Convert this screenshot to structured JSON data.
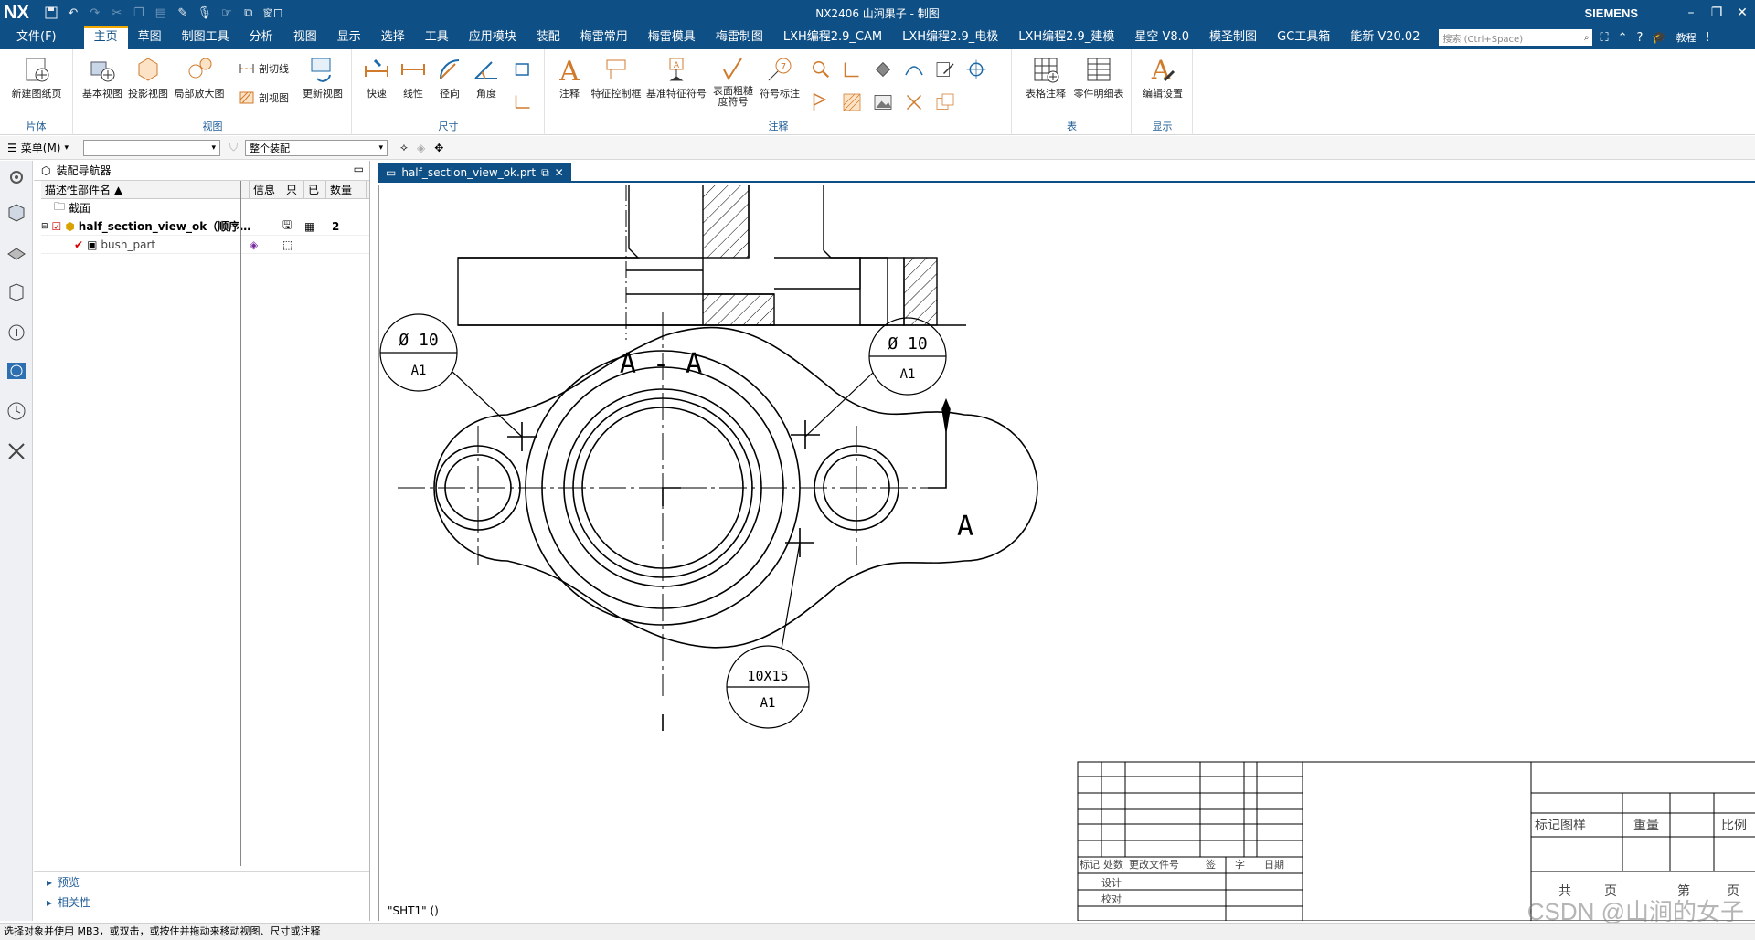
{
  "app": {
    "logo": "NX",
    "title": "NX2406 山涧果子 - 制图",
    "brand": "SIEMENS",
    "quick_window": "窗口"
  },
  "menu": {
    "file": "文件(F)",
    "items": [
      "主页",
      "草图",
      "制图工具",
      "分析",
      "视图",
      "显示",
      "选择",
      "工具",
      "应用模块",
      "装配",
      "梅雷常用",
      "梅雷模具",
      "梅雷制图",
      "LXH编程2.9_CAM",
      "LXH编程2.9_电极",
      "LXH编程2.9_建模",
      "星空 V8.0",
      "模圣制图",
      "GC工具箱",
      "能新 V20.02"
    ],
    "search_placeholder": "搜索 (Ctrl+Space)",
    "tutorial": "教程"
  },
  "ribbon": {
    "groups": {
      "sheet": "片体",
      "view": "视图",
      "dimension": "尺寸",
      "annotation": "注释",
      "table": "表",
      "display": "显示"
    },
    "buttons": {
      "new_sheet": "新建图纸页",
      "base_view": "基本视图",
      "projected_view": "投影视图",
      "detail_view": "局部放大图",
      "section_line": "剖切线",
      "section_view": "剖视图",
      "update_view": "更新视图",
      "rapid": "快速",
      "linear": "线性",
      "radial": "径向",
      "angular": "角度",
      "note": "注释",
      "fcf": "特征控制框",
      "datum": "基准特征符号",
      "surface_finish": "表面粗糙度符号",
      "id_symbol": "符号标注",
      "tabular_note": "表格注释",
      "parts_list": "零件明细表",
      "edit_settings": "编辑设置"
    }
  },
  "selbar": {
    "menu": "菜单(M)",
    "filter": "",
    "scope": "整个装配"
  },
  "navigator": {
    "title": "装配导航器",
    "columns": [
      "描述性部件名",
      "信息",
      "只",
      "已",
      "数量"
    ],
    "rows": [
      {
        "name": "截面",
        "qty": ""
      },
      {
        "name": "half_section_view_ok（顺序…",
        "qty": "2"
      },
      {
        "name": "bush_part",
        "qty": ""
      }
    ],
    "panels": [
      "预览",
      "相关性"
    ]
  },
  "tab": {
    "label": "half_section_view_ok.prt"
  },
  "drawing": {
    "section_label": "A - A",
    "arrow_label": "A",
    "balloon1": {
      "top": "Ø 10",
      "bottom": "A1"
    },
    "balloon2": {
      "top": "Ø 10",
      "bottom": "A1"
    },
    "balloon3": {
      "top": "10X15",
      "bottom": "A1"
    },
    "title_block": {
      "row_labels": [
        "标记",
        "处数",
        "更改文件号",
        "签",
        "字",
        "日期"
      ],
      "design": "设计",
      "check": "校对",
      "mark_pattern": "标记图样",
      "weight": "重量",
      "scale": "比例",
      "total": "共",
      "page": "页",
      "no": "第",
      "page2": "页"
    },
    "sheet_name": "\"SHT1\" ()"
  },
  "status": {
    "message": "选择对象并使用 MB3，或双击，或按住并拖动来移动视图、尺寸或注释"
  },
  "watermark": "CSDN @山涧的女子"
}
